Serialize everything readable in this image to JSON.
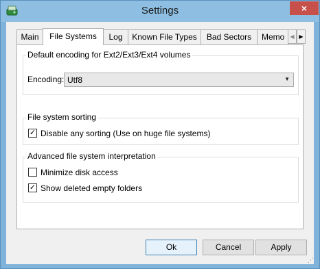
{
  "window": {
    "title": "Settings",
    "close_glyph": "×",
    "app_icon": "drive-icon"
  },
  "tabs": [
    {
      "label": "Main",
      "active": false
    },
    {
      "label": "File Systems",
      "active": true
    },
    {
      "label": "Log",
      "active": false
    },
    {
      "label": "Known File Types",
      "active": false
    },
    {
      "label": "Bad Sectors",
      "active": false
    },
    {
      "label": "Memo",
      "active": false
    }
  ],
  "tab_scroll": {
    "left_glyph": "◀",
    "right_glyph": "▶"
  },
  "encoding_group": {
    "title": "Default encoding for Ext2/Ext3/Ext4 volumes",
    "label": "Encoding:",
    "value": "Utf8",
    "arrow_glyph": "▼"
  },
  "sorting_group": {
    "title": "File system sorting",
    "options": [
      {
        "label": "Disable any sorting (Use on huge file systems)",
        "checked": true
      }
    ]
  },
  "advanced_group": {
    "title": "Advanced file system interpretation",
    "options": [
      {
        "label": "Minimize disk access",
        "checked": false
      },
      {
        "label": "Show deleted empty folders",
        "checked": true
      }
    ]
  },
  "buttons": {
    "ok": "Ok",
    "cancel": "Cancel",
    "apply": "Apply"
  },
  "check_glyph": "✓"
}
